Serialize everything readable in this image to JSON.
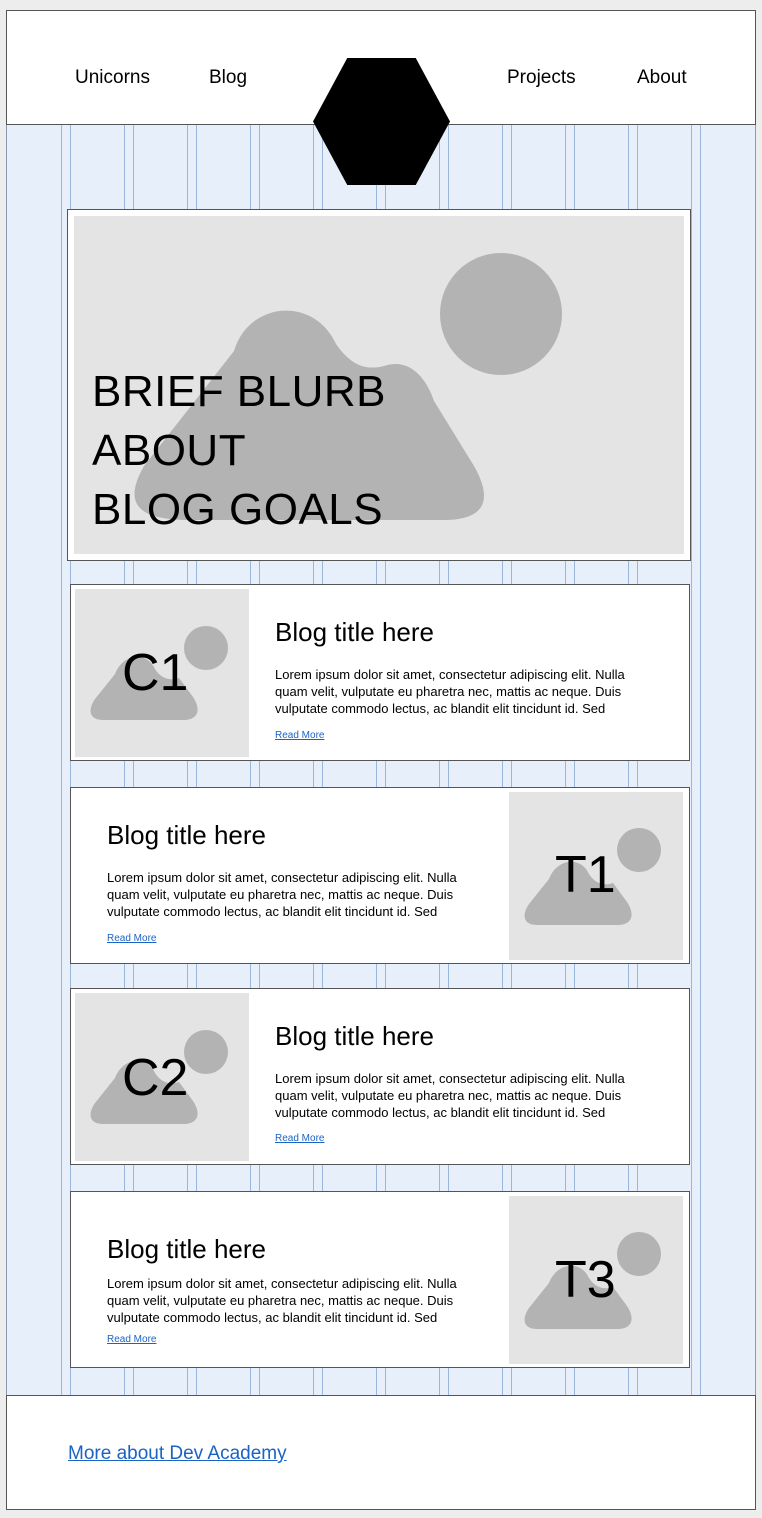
{
  "nav": {
    "items": [
      {
        "label": "Unicorns"
      },
      {
        "label": "Blog"
      },
      {
        "label": "Projects"
      },
      {
        "label": "About"
      }
    ],
    "logo_icon": "hexagon-logo-icon"
  },
  "hero": {
    "blurb": "BRIEF BLURB\nABOUT\nBLOG GOALS",
    "image_icon": "image-placeholder-icon"
  },
  "posts": [
    {
      "code": "C1",
      "title": "Blog title here",
      "excerpt": "Lorem ipsum dolor sit amet, consectetur adipiscing elit. Nulla quam velit, vulputate eu pharetra nec, mattis ac neque. Duis vulputate commodo lectus, ac blandit elit tincidunt id. Sed",
      "read_more": "Read More"
    },
    {
      "code": "T1",
      "title": "Blog title here",
      "excerpt": "Lorem ipsum dolor sit amet, consectetur adipiscing elit. Nulla quam velit, vulputate eu pharetra nec, mattis ac neque. Duis vulputate commodo lectus, ac blandit elit tincidunt id. Sed",
      "read_more": "Read More"
    },
    {
      "code": "C2",
      "title": "Blog title here",
      "excerpt": "Lorem ipsum dolor sit amet, consectetur adipiscing elit. Nulla quam velit, vulputate eu pharetra nec, mattis ac neque. Duis vulputate commodo lectus, ac blandit elit tincidunt id. Sed",
      "read_more": "Read More"
    },
    {
      "code": "T3",
      "title": "Blog title here",
      "excerpt": "Lorem ipsum dolor sit amet, consectetur adipiscing elit. Nulla quam velit, vulputate eu pharetra nec, mattis ac neque. Duis vulputate commodo lectus, ac blandit elit tincidunt id. Sed",
      "read_more": "Read More"
    }
  ],
  "footer": {
    "link": "More about Dev Academy"
  },
  "colors": {
    "grid_background": "#e6effa",
    "grid_lines": "#9ab6da",
    "placeholder_fill": "#e4e4e4",
    "placeholder_shape": "#b3b3b3",
    "link": "#1a63c4"
  }
}
